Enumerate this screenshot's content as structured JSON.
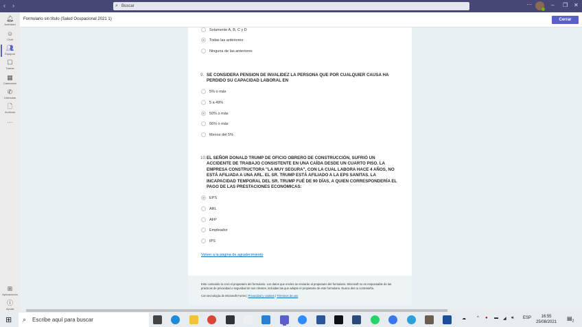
{
  "app": {
    "search_placeholder": "Buscar",
    "window_title": "Formulario sin título (Salud Ocupacional 2021 1)",
    "close_label": "Cerrar",
    "more": "···"
  },
  "rail": [
    {
      "label": "Actividad",
      "icon": "bell-icon"
    },
    {
      "label": "Chat",
      "icon": "chat-icon"
    },
    {
      "label": "Equipos",
      "icon": "teams-icon"
    },
    {
      "label": "Tareas",
      "icon": "tasks-icon"
    },
    {
      "label": "Calendario",
      "icon": "calendar-icon"
    },
    {
      "label": "Llamadas",
      "icon": "phone-icon"
    },
    {
      "label": "Archivos",
      "icon": "file-icon"
    },
    {
      "label": "···",
      "icon": "more-icon"
    },
    {
      "label": "Aplicaciones",
      "icon": "apps-icon"
    },
    {
      "label": "Ayuda",
      "icon": "help-icon"
    }
  ],
  "form": {
    "prev_options": [
      {
        "label": "Solamente A, B, C y D",
        "checked": false
      },
      {
        "label": "Todas las anteriores",
        "checked": true
      },
      {
        "label": "Ninguna de las anteriores",
        "checked": false
      }
    ],
    "q9": {
      "number": "9.",
      "text": "SE CONSIDERA PENSION DE INVALIDEZ LA PERSONA QUE POR CUALQUIER CAUSA HA PERDIDO SU CAPACIDAD LABORAL EN",
      "options": [
        {
          "label": "5% o más",
          "checked": false
        },
        {
          "label": "5 a 49%",
          "checked": false
        },
        {
          "label": "50% o más",
          "checked": true
        },
        {
          "label": "66% o más",
          "checked": false
        },
        {
          "label": "Menos del 5%",
          "checked": false
        }
      ]
    },
    "q10": {
      "number": "10.",
      "text": "EL SEÑOR DONALD TRUMP DE OFICIO OBRERO DE CONSTRUCCIÓN, SUFRIÓ UN ACCIDENTE DE TRABAJO CONSISTENTE EN UNA CAÍDA DESDE UN CUARTO PISO. LA EMPRESA CONSTRUCTORA \"LA MUY SEGURA\", CON LA CUAL LABORA HACE 4 AÑOS, NO ESTÁ AFILIADA A UNA ARL. EL SR. TRUMP ESTÁ AFILIADO A LA EPS SANITAS. LA INCAPACIDAD TEMPORAL DEL SR. TRUMP FUÉ DE 90 DÍAS, A QUIEN CORRESPONDERÍA EL PAGO DE LAS PRESTACIONES ECONÓMICAS:",
      "options": [
        {
          "label": "EPS",
          "checked": true
        },
        {
          "label": "ARL",
          "checked": false
        },
        {
          "label": "AFP",
          "checked": false
        },
        {
          "label": "Empleador",
          "checked": false
        },
        {
          "label": "IPS",
          "checked": false
        }
      ]
    },
    "back_link": "Volver a la página de agradecimiento"
  },
  "footer": {
    "disclaimer": "Este contenido lo creó el propietario del formulario. Los datos que envíes se enviarán al propietario del formulario. Microsoft no es responsable de las prácticas de privacidad o seguridad de sus clientes, incluidas las que adopte el propietario de este formulario. Nunca des tu contraseña.",
    "powered": "Con tecnología de Microsoft Forms |",
    "privacy": "Privacidad y cookies",
    "sep": "|",
    "terms": "Términos de uso"
  },
  "taskbar": {
    "search_placeholder": "Escribe aquí para buscar",
    "apps": [
      {
        "name": "task-view",
        "color": "#444"
      },
      {
        "name": "edge",
        "color": "#1f8ad6"
      },
      {
        "name": "file-explorer",
        "color": "#f3c13a"
      },
      {
        "name": "chrome",
        "color": "#db4437"
      },
      {
        "name": "store",
        "color": "#333"
      },
      {
        "name": "amazon",
        "color": "#f0f0f0"
      },
      {
        "name": "mail",
        "color": "#2a7fd4"
      },
      {
        "name": "teams",
        "color": "#5b5fc7"
      },
      {
        "name": "zoom",
        "color": "#2d8cff"
      },
      {
        "name": "word",
        "color": "#2b579a"
      },
      {
        "name": "netflix",
        "color": "#111"
      },
      {
        "name": "dvd-app",
        "color": "#2a4a7a"
      },
      {
        "name": "whatsapp",
        "color": "#25d366"
      },
      {
        "name": "signal",
        "color": "#3a76f0"
      },
      {
        "name": "telegram",
        "color": "#2aa1da"
      },
      {
        "name": "gimp",
        "color": "#6b5d4f"
      },
      {
        "name": "network-app",
        "color": "#1a4f9c"
      }
    ],
    "language": "ESP",
    "time": "16:55",
    "date": "25/08/2021",
    "notifications": "2"
  }
}
